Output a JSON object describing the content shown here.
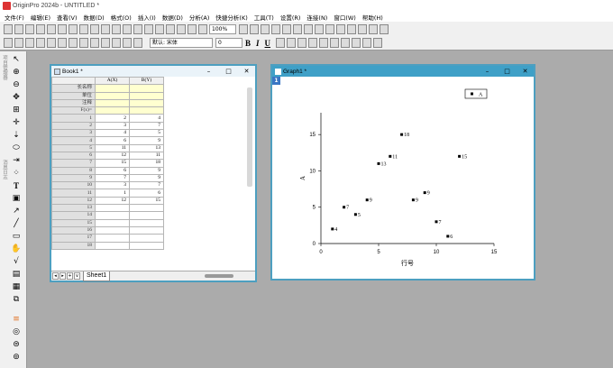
{
  "app": {
    "title": "OriginPro 2024b - UNTITLED *"
  },
  "menu": [
    "文件(F)",
    "编辑(E)",
    "查看(V)",
    "数据(D)",
    "格式(O)",
    "插入(I)",
    "数据(D)",
    "分析(A)",
    "快捷分析(K)",
    "工具(T)",
    "设置(R)",
    "连接(N)",
    "窗口(W)",
    "帮助(H)"
  ],
  "toolbar": {
    "zoom": "100%",
    "font": "默认: 宋体",
    "size": "0",
    "bold": "B",
    "italic": "I",
    "underline": "U"
  },
  "left_toolbar": {
    "label1": "项目管理器",
    "label2": "消息日志"
  },
  "book": {
    "title": "Book1 *",
    "col_a": "A(X)",
    "col_b": "B(Y)",
    "meta_rows": [
      "长名称",
      "单位",
      "注释",
      "F(x)="
    ],
    "rows": [
      [
        "1",
        "2",
        "4"
      ],
      [
        "2",
        "3",
        "7"
      ],
      [
        "3",
        "4",
        "5"
      ],
      [
        "4",
        "6",
        "9"
      ],
      [
        "5",
        "11",
        "13"
      ],
      [
        "6",
        "12",
        "11"
      ],
      [
        "7",
        "15",
        "18"
      ],
      [
        "8",
        "6",
        "9"
      ],
      [
        "9",
        "7",
        "9"
      ],
      [
        "10",
        "3",
        "7"
      ],
      [
        "11",
        "1",
        "6"
      ],
      [
        "12",
        "12",
        "15"
      ],
      [
        "13",
        "",
        ""
      ],
      [
        "14",
        "",
        ""
      ],
      [
        "15",
        "",
        ""
      ],
      [
        "16",
        "",
        ""
      ],
      [
        "17",
        "",
        ""
      ],
      [
        "18",
        "",
        ""
      ]
    ],
    "sheet_tab": "Sheet1"
  },
  "graph": {
    "title": "Graph1 *",
    "layer": "1"
  },
  "chart_data": {
    "type": "scatter",
    "xlabel": "行号",
    "ylabel": "A",
    "xlim": [
      0,
      15
    ],
    "ylim": [
      0,
      18
    ],
    "xticks": [
      "0",
      "5",
      "10",
      "15"
    ],
    "yticks": [
      "0",
      "5",
      "10",
      "15"
    ],
    "legend": "A",
    "legend_position": "top-right",
    "series": [
      {
        "name": "A",
        "points": [
          {
            "x": 1,
            "y": 2,
            "label": "4"
          },
          {
            "x": 2,
            "y": 5,
            "label": "7"
          },
          {
            "x": 3,
            "y": 4,
            "label": "5"
          },
          {
            "x": 4,
            "y": 6,
            "label": "9"
          },
          {
            "x": 5,
            "y": 11,
            "label": "13"
          },
          {
            "x": 6,
            "y": 12,
            "label": "11"
          },
          {
            "x": 7,
            "y": 15,
            "label": "18"
          },
          {
            "x": 8,
            "y": 6,
            "label": "9"
          },
          {
            "x": 9,
            "y": 7,
            "label": "9"
          },
          {
            "x": 10,
            "y": 3,
            "label": "7"
          },
          {
            "x": 11,
            "y": 1,
            "label": "6"
          },
          {
            "x": 12,
            "y": 12,
            "label": "15"
          }
        ]
      }
    ]
  }
}
